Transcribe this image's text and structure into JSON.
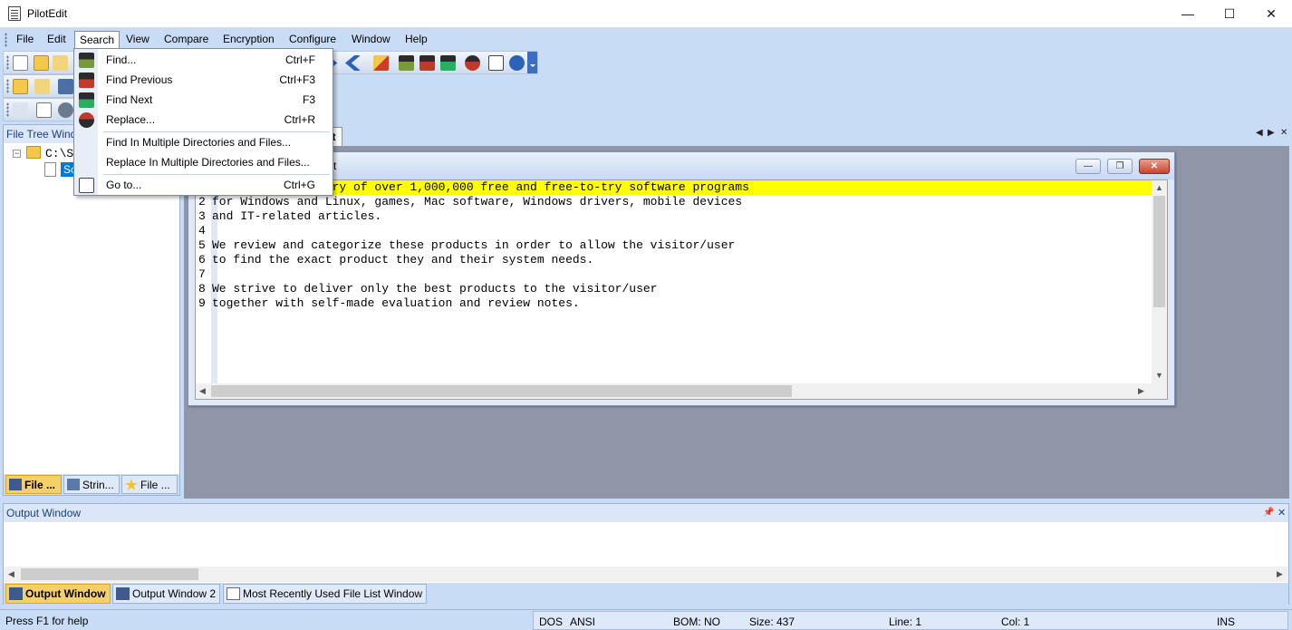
{
  "window": {
    "title": "PilotEdit",
    "minimize_glyph": "—",
    "maximize_glyph": "☐",
    "close_glyph": "✕"
  },
  "menubar": {
    "items": [
      "File",
      "Edit",
      "Search",
      "View",
      "Compare",
      "Encryption",
      "Configure",
      "Window",
      "Help"
    ],
    "active": "Search"
  },
  "search_menu": {
    "items": [
      {
        "label": "Find...",
        "shortcut": "Ctrl+F",
        "icon": "find-icon"
      },
      {
        "label": "Find Previous",
        "shortcut": "Ctrl+F3",
        "icon": "find-previous-icon"
      },
      {
        "label": "Find Next",
        "shortcut": "F3",
        "icon": "find-next-icon"
      },
      {
        "label": "Replace...",
        "shortcut": "Ctrl+R",
        "icon": "replace-icon"
      },
      {
        "label": "Find In Multiple Directories and Files...",
        "shortcut": "",
        "icon": ""
      },
      {
        "label": "Replace In Multiple Directories and Files...",
        "shortcut": "",
        "icon": ""
      },
      {
        "label": "Go to...",
        "shortcut": "Ctrl+G",
        "icon": "goto-icon"
      }
    ]
  },
  "left_pane": {
    "title": "File Tree Wind",
    "tree_root": "C:\\S",
    "tree_child": "Sc",
    "expander": "−",
    "tabs": [
      "File ...",
      "Strin...",
      "File ..."
    ],
    "active_tab": "File ..."
  },
  "document": {
    "tab_label": "xt",
    "window_title": "t",
    "nav_left": "◀",
    "nav_right": "▶",
    "nav_close": "✕",
    "btn_minimize": "—",
    "btn_restore": "❐",
    "btn_close": "✕",
    "lines": [
      {
        "n": "1",
        "text": "              brary of over 1,000,000 free and free-to-try software programs",
        "highlight": true
      },
      {
        "n": "2",
        "text": "for Windows and Linux, games, Mac software, Windows drivers, mobile devices",
        "highlight": false
      },
      {
        "n": "3",
        "text": "and IT-related articles.",
        "highlight": false
      },
      {
        "n": "4",
        "text": "",
        "highlight": false
      },
      {
        "n": "5",
        "text": "We review and categorize these products in order to allow the visitor/user",
        "highlight": false
      },
      {
        "n": "6",
        "text": "to find the exact product they and their system needs.",
        "highlight": false
      },
      {
        "n": "7",
        "text": "",
        "highlight": false
      },
      {
        "n": "8",
        "text": "We strive to deliver only the best products to the visitor/user",
        "highlight": false
      },
      {
        "n": "9",
        "text": "together with self-made evaluation and review notes.",
        "highlight": false
      }
    ],
    "scroll_up": "▲",
    "scroll_down": "▼",
    "scroll_left": "◀",
    "scroll_right": "▶"
  },
  "output_pane": {
    "title": "Output Window",
    "pin_glyph": "📌",
    "close_glyph": "✕",
    "scroll_left": "◀",
    "scroll_right": "▶",
    "tabs": [
      "Output Window",
      "Output Window 2",
      "Most Recently Used File List Window"
    ],
    "active_tab": "Output Window"
  },
  "statusbar": {
    "help": "Press F1 for help",
    "line_ending": "DOS",
    "encoding": "ANSI",
    "bom": "BOM: NO",
    "size": "Size: 437",
    "line": "Line: 1",
    "col": "Col: 1",
    "mode": "INS"
  },
  "colors": {
    "chrome": "#c9dcf5",
    "highlight_line": "#ffff00",
    "selection": "#0078d7",
    "active_tab": "#f5cf6a",
    "mdi_background": "#8e96a8"
  }
}
